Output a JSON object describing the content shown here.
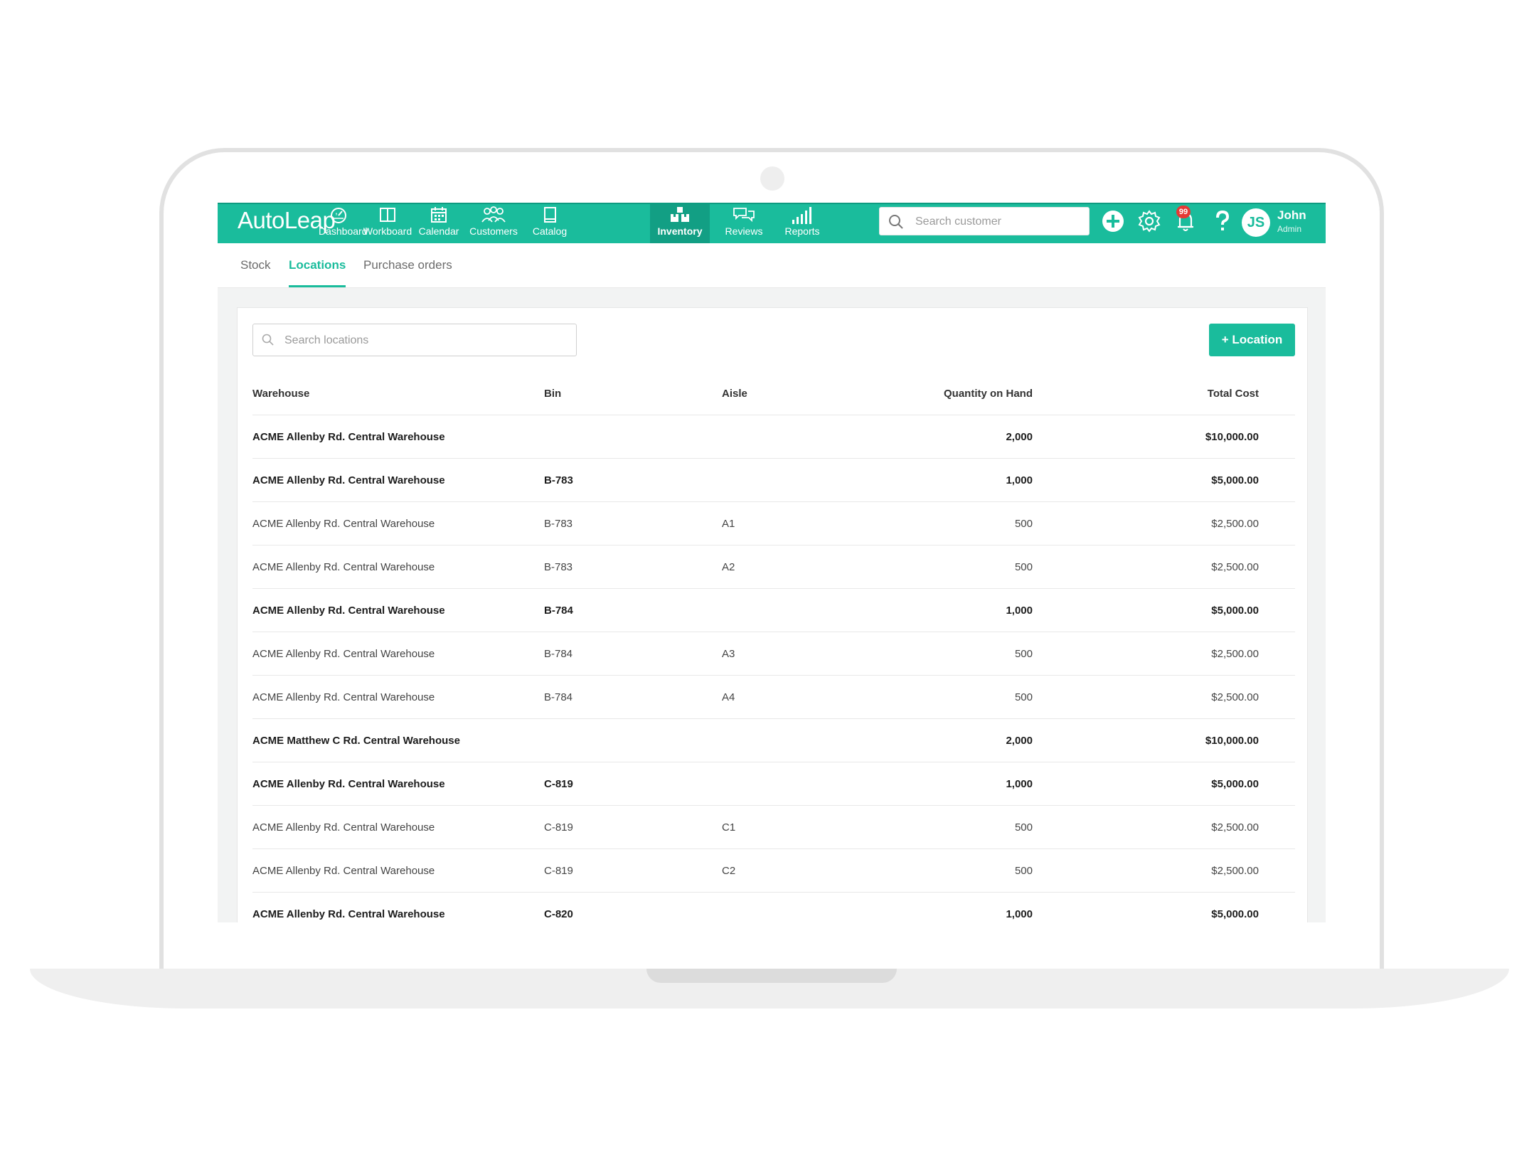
{
  "app": {
    "logo": "AutoLeap",
    "logo_mark": "’"
  },
  "nav": [
    {
      "label": "Dashboard",
      "icon": "gauge-icon",
      "active": false
    },
    {
      "label": "Workboard",
      "icon": "columns-icon",
      "active": false
    },
    {
      "label": "Calendar",
      "icon": "calendar-icon",
      "active": false
    },
    {
      "label": "Customers",
      "icon": "users-icon",
      "active": false
    },
    {
      "label": "Catalog",
      "icon": "book-icon",
      "active": false
    },
    {
      "label": "Inventory",
      "icon": "boxes-icon",
      "active": true
    },
    {
      "label": "Reviews",
      "icon": "chat-bubbles-icon",
      "active": false
    },
    {
      "label": "Reports",
      "icon": "bar-signal-icon",
      "active": false
    }
  ],
  "header": {
    "search_placeholder": "Search customer",
    "notification_count": "99",
    "user_initials": "JS",
    "user_name": "John",
    "user_role": "Admin"
  },
  "subtabs": [
    {
      "label": "Stock",
      "active": false
    },
    {
      "label": "Locations",
      "active": true
    },
    {
      "label": "Purchase orders",
      "active": false
    }
  ],
  "locations": {
    "search_placeholder": "Search locations",
    "add_button": "+ Location",
    "columns": {
      "warehouse": "Warehouse",
      "bin": "Bin",
      "aisle": "Aisle",
      "quantity": "Quantity on Hand",
      "cost": "Total Cost"
    },
    "rows": [
      {
        "warehouse": "ACME Allenby Rd. Central Warehouse",
        "bin": "",
        "aisle": "",
        "quantity": "2,000",
        "cost": "$10,000.00",
        "bold": true
      },
      {
        "warehouse": "ACME Allenby Rd. Central Warehouse",
        "bin": "B-783",
        "aisle": "",
        "quantity": "1,000",
        "cost": "$5,000.00",
        "bold": true
      },
      {
        "warehouse": "ACME Allenby Rd. Central Warehouse",
        "bin": "B-783",
        "aisle": "A1",
        "quantity": "500",
        "cost": "$2,500.00",
        "bold": false
      },
      {
        "warehouse": "ACME Allenby Rd. Central Warehouse",
        "bin": "B-783",
        "aisle": "A2",
        "quantity": "500",
        "cost": "$2,500.00",
        "bold": false
      },
      {
        "warehouse": "ACME Allenby Rd. Central Warehouse",
        "bin": "B-784",
        "aisle": "",
        "quantity": "1,000",
        "cost": "$5,000.00",
        "bold": true
      },
      {
        "warehouse": "ACME Allenby Rd. Central Warehouse",
        "bin": "B-784",
        "aisle": "A3",
        "quantity": "500",
        "cost": "$2,500.00",
        "bold": false
      },
      {
        "warehouse": "ACME Allenby Rd. Central Warehouse",
        "bin": "B-784",
        "aisle": "A4",
        "quantity": "500",
        "cost": "$2,500.00",
        "bold": false
      },
      {
        "warehouse": "ACME Matthew C Rd. Central Warehouse",
        "bin": "",
        "aisle": "",
        "quantity": "2,000",
        "cost": "$10,000.00",
        "bold": true
      },
      {
        "warehouse": "ACME Allenby Rd. Central Warehouse",
        "bin": "C-819",
        "aisle": "",
        "quantity": "1,000",
        "cost": "$5,000.00",
        "bold": true
      },
      {
        "warehouse": "ACME Allenby Rd. Central Warehouse",
        "bin": "C-819",
        "aisle": "C1",
        "quantity": "500",
        "cost": "$2,500.00",
        "bold": false
      },
      {
        "warehouse": "ACME Allenby Rd. Central Warehouse",
        "bin": "C-819",
        "aisle": "C2",
        "quantity": "500",
        "cost": "$2,500.00",
        "bold": false
      },
      {
        "warehouse": "ACME Allenby Rd. Central Warehouse",
        "bin": "C-820",
        "aisle": "",
        "quantity": "1,000",
        "cost": "$5,000.00",
        "bold": true
      }
    ]
  },
  "colors": {
    "brand": "#1abc9c",
    "brand_dark": "#129f84",
    "badge": "#e53935"
  }
}
